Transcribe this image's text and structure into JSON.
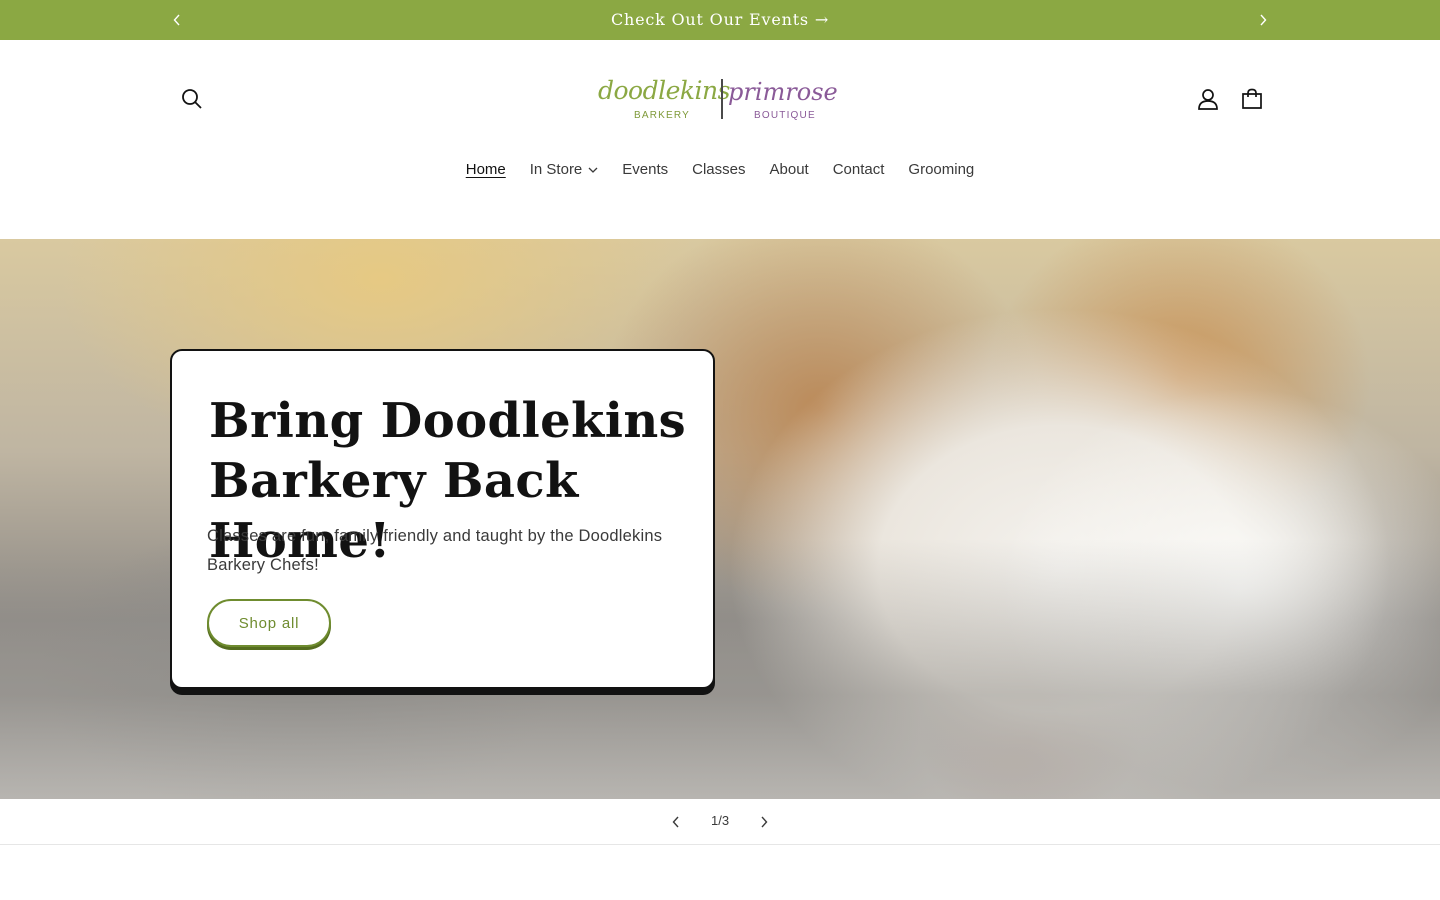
{
  "announcement": {
    "message": "Check Out Our Events →",
    "prev_icon": "chevron-left-icon",
    "next_icon": "chevron-right-icon"
  },
  "header": {
    "logo": {
      "left_word": "doodlekins",
      "right_word": "primrose",
      "left_sub": "BARKERY",
      "right_sub": "BOUTIQUE"
    },
    "icons": [
      "search-icon",
      "account-icon",
      "cart-icon"
    ]
  },
  "nav": {
    "items": [
      {
        "label": "Home",
        "active": true
      },
      {
        "label": "In Store",
        "dropdown": true
      },
      {
        "label": "Events"
      },
      {
        "label": "Classes"
      },
      {
        "label": "About"
      },
      {
        "label": "Contact"
      },
      {
        "label": "Grooming"
      }
    ]
  },
  "hero": {
    "title": "Bring Doodlekins Barkery Back Home!",
    "text": "Classes are fun, family friendly and taught by the Doodlekins Barkery Chefs!",
    "button_label": "Shop all"
  },
  "slider": {
    "current": "1",
    "separator": "/",
    "total": "3"
  },
  "colors": {
    "announcement_bg": "#8ba843",
    "button_accent": "#6f8c2f",
    "logo_green": "#8ba843",
    "logo_purple": "#8a5a98"
  }
}
